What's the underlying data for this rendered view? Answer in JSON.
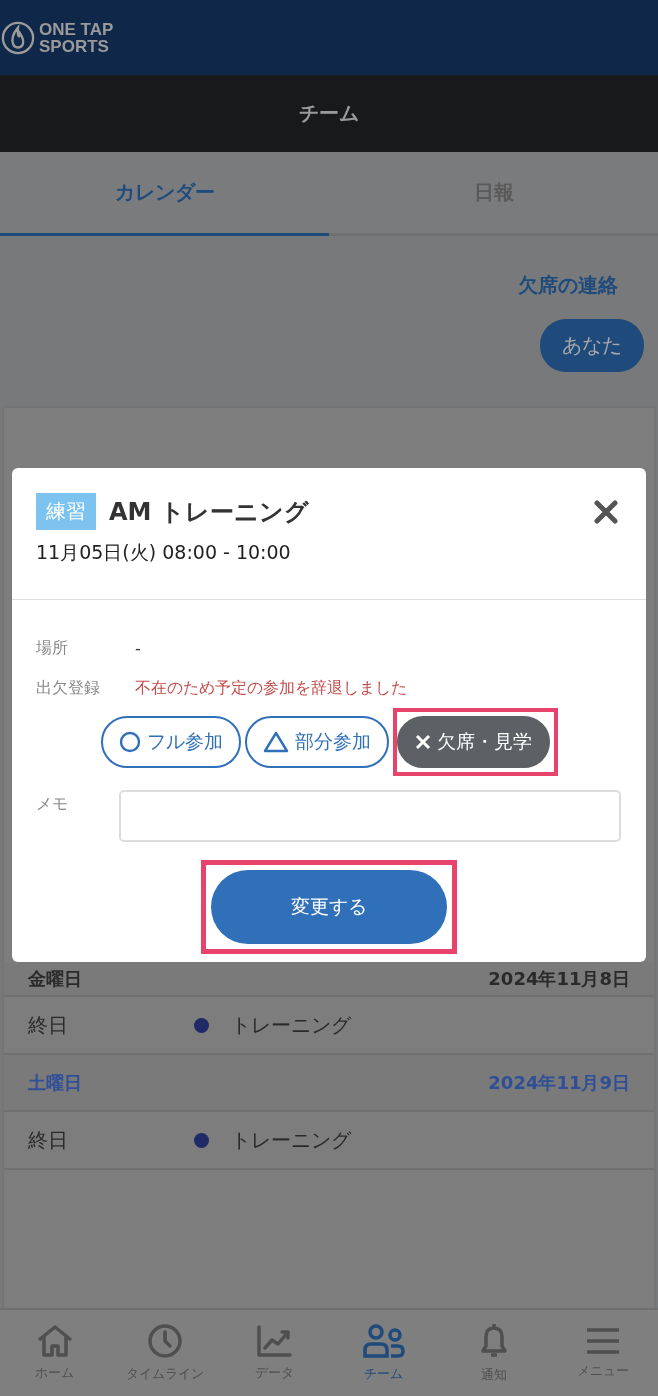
{
  "header": {
    "logo_line_1": "ONE TAP",
    "logo_line_2": "SPORTS"
  },
  "title_bar": {
    "title": "チーム"
  },
  "tabs": [
    {
      "label": "カレンダー",
      "selected": true
    },
    {
      "label": "日報",
      "selected": false
    }
  ],
  "absence_link": "欠席の連絡",
  "member_pill": "あなた",
  "calendar": {
    "days": [
      {
        "kind": "weekday",
        "weekday": "金曜日",
        "date": "2024年11月8日",
        "events": [
          {
            "time": "終日",
            "title": "トレーニング",
            "color": "#1f2a66"
          }
        ]
      },
      {
        "kind": "saturday",
        "weekday": "土曜日",
        "date": "2024年11月9日",
        "events": [
          {
            "time": "終日",
            "title": "トレーニング",
            "color": "#1f2a66"
          }
        ]
      }
    ]
  },
  "modal": {
    "category": "練習",
    "title": "AM トレーニング",
    "datetime": "11月05日(火) 08:00 - 10:00",
    "fields": [
      {
        "label": "場所",
        "value": "-"
      }
    ],
    "attendance": {
      "label": "出欠登録",
      "message": "不在のため予定の参加を辞退しました",
      "options": [
        {
          "kind": "full",
          "label": "フル参加",
          "selected": false,
          "highlighted": false
        },
        {
          "kind": "partial",
          "label": "部分参加",
          "selected": false,
          "highlighted": false
        },
        {
          "kind": "absent",
          "label": "欠席・見学",
          "selected": true,
          "highlighted": true
        }
      ]
    },
    "memo": {
      "label": "メモ"
    },
    "submit": {
      "label": "変更する",
      "highlighted": true
    }
  },
  "bottom_nav": [
    {
      "kind": "home",
      "label": "ホーム",
      "selected": false
    },
    {
      "kind": "timeline",
      "label": "タイムライン",
      "selected": false
    },
    {
      "kind": "data",
      "label": "データ",
      "selected": false
    },
    {
      "kind": "team",
      "label": "チーム",
      "selected": true
    },
    {
      "kind": "notice",
      "label": "通知",
      "selected": false
    },
    {
      "kind": "menu",
      "label": "メニュー",
      "selected": false
    }
  ]
}
